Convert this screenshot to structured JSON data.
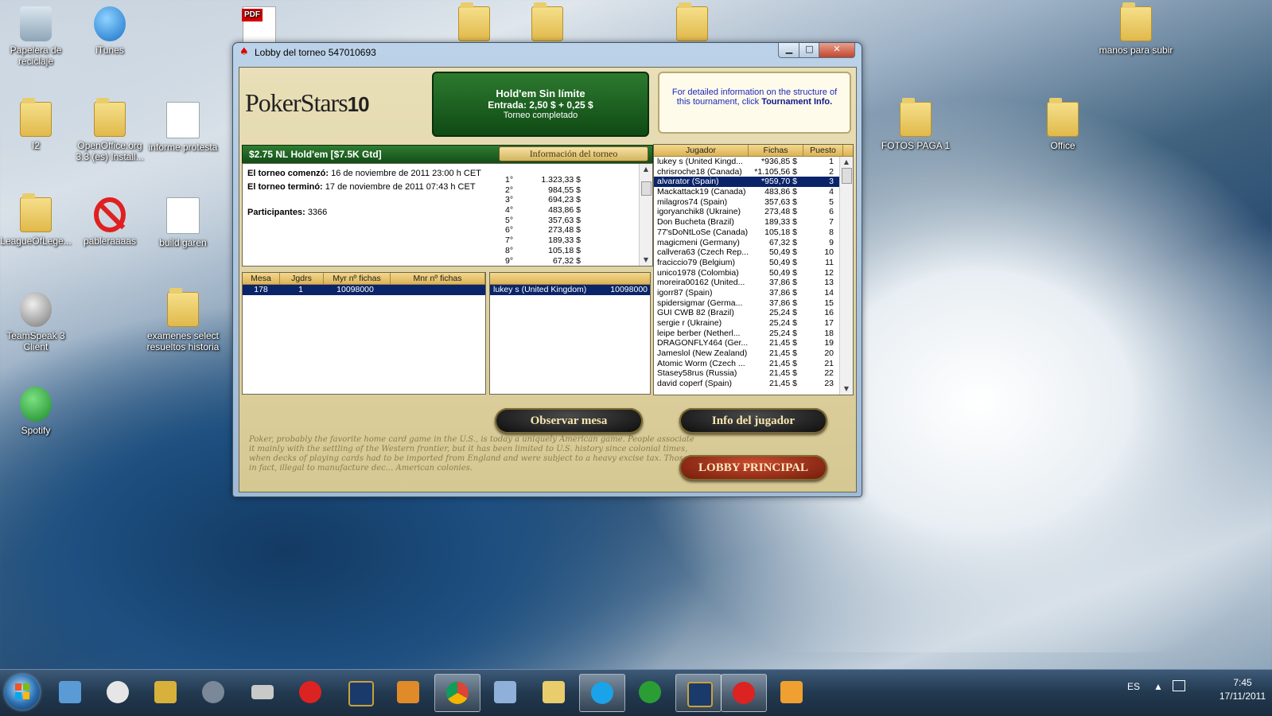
{
  "desktop": {
    "icons": [
      {
        "label": "Papelera de reciclaje",
        "icon": "recycle-bin-icon"
      },
      {
        "label": "iTunes",
        "icon": "itunes-icon"
      },
      {
        "label": "I2",
        "icon": "folder-icon"
      },
      {
        "label": "OpenOffice.org 3.3 (es) Install...",
        "icon": "folder-icon"
      },
      {
        "label": "informe protesta",
        "icon": "document-icon"
      },
      {
        "label": "LeagueOfLege...",
        "icon": "folder-icon"
      },
      {
        "label": "pableraaaas",
        "icon": "no-entry-icon"
      },
      {
        "label": "build garen",
        "icon": "document-icon"
      },
      {
        "label": "TeamSpeak 3 Client",
        "icon": "teamspeak-icon"
      },
      {
        "label": "examenes select resueltos historia",
        "icon": "folder-icon"
      },
      {
        "label": "Spotify",
        "icon": "spotify-icon"
      },
      {
        "label": "manos para subir",
        "icon": "folder-icon"
      },
      {
        "label": "FOTOS PAGA 1",
        "icon": "folder-icon"
      },
      {
        "label": "Office",
        "icon": "folder-icon"
      }
    ]
  },
  "window": {
    "title": "Lobby del torneo 547010693",
    "logo_text": "PokerStars",
    "logo_badge": "10",
    "game": {
      "name": "Hold'em Sin límite",
      "entry": "Entrada: 2,50 $ + 0,25 $",
      "status": "Torneo completado"
    },
    "info_text": "For detailed information on the structure of this tournament, click",
    "info_link": "Tournament Info.",
    "tournament_name": "$2.75 NL Hold'em [$7.5K Gtd]",
    "tournament_info_button": "Información del torneo",
    "started_label": "El torneo comenzó:",
    "started_value": "16 de noviembre de 2011 23:00 h CET",
    "ended_label": "El torneo terminó:",
    "ended_value": "17 de noviembre de 2011 07:43 h CET",
    "participants_label": "Participantes:",
    "participants_value": "3366",
    "prizes": [
      {
        "place": "1°",
        "amount": "1.323,33 $"
      },
      {
        "place": "2°",
        "amount": "984,55 $"
      },
      {
        "place": "3°",
        "amount": "694,23 $"
      },
      {
        "place": "4°",
        "amount": "483,86 $"
      },
      {
        "place": "5°",
        "amount": "357,63 $"
      },
      {
        "place": "6°",
        "amount": "273,48 $"
      },
      {
        "place": "7°",
        "amount": "189,33 $"
      },
      {
        "place": "8°",
        "amount": "105,18 $"
      },
      {
        "place": "9°",
        "amount": "67,32 $"
      }
    ],
    "tables": {
      "headers": [
        "Mesa",
        "Jgdrs",
        "Myr nº fichas",
        "Mnr nº fichas"
      ],
      "rows": [
        [
          "178",
          "1",
          "10098000",
          ""
        ]
      ]
    },
    "table_players": [
      {
        "name": "lukey s (United Kingdom)",
        "chips": "10098000"
      }
    ],
    "players": {
      "headers": [
        "Jugador",
        "Fichas",
        "Puesto"
      ],
      "rows": [
        [
          "lukey s (United Kingd...",
          "*936,85 $",
          "1"
        ],
        [
          "chrisroche18 (Canada)",
          "*1.105,56 $",
          "2"
        ],
        [
          "alvarator (Spain)",
          "*959,70 $",
          "3"
        ],
        [
          "Mackattack19 (Canada)",
          "483,86 $",
          "4"
        ],
        [
          "milagros74 (Spain)",
          "357,63 $",
          "5"
        ],
        [
          "igoryanchik8 (Ukraine)",
          "273,48 $",
          "6"
        ],
        [
          "Don Bucheta (Brazil)",
          "189,33 $",
          "7"
        ],
        [
          "77'sDoNtLoSe (Canada)",
          "105,18 $",
          "8"
        ],
        [
          "magicmeni (Germany)",
          "67,32 $",
          "9"
        ],
        [
          "callvera63 (Czech Rep...",
          "50,49 $",
          "10"
        ],
        [
          "fraciccio79 (Belgium)",
          "50,49 $",
          "11"
        ],
        [
          "unico1978 (Colombia)",
          "50,49 $",
          "12"
        ],
        [
          "moreira00162 (United...",
          "37,86 $",
          "13"
        ],
        [
          "igorr87 (Spain)",
          "37,86 $",
          "14"
        ],
        [
          "spidersigmar (Germa...",
          "37,86 $",
          "15"
        ],
        [
          "GUI CWB 82 (Brazil)",
          "25,24 $",
          "16"
        ],
        [
          "sergie r (Ukraine)",
          "25,24 $",
          "17"
        ],
        [
          "leipe berber (Netherl...",
          "25,24 $",
          "18"
        ],
        [
          "DRAGONFLY464 (Ger...",
          "21,45 $",
          "19"
        ],
        [
          "Jameslol (New Zealand)",
          "21,45 $",
          "20"
        ],
        [
          "Atomic Worm (Czech ...",
          "21,45 $",
          "21"
        ],
        [
          "Stasey58rus (Russia)",
          "21,45 $",
          "22"
        ],
        [
          "david coperf (Spain)",
          "21,45 $",
          "23"
        ]
      ],
      "selected_index": 2
    },
    "buttons": {
      "observe": "Observar mesa",
      "player_info": "Info del jugador",
      "main_lobby": "LOBBY PRINCIPAL"
    },
    "background_script": "Poker, probably the favorite home card game in the U.S., is today a uniquely American game. People associate it mainly with the settling of the Western frontier, but it has been limited to U.S. history since colonial times, when decks of playing cards had to be imported from England and were subject to a heavy excise tax. Those, in fact, illegal to manufacture dec... American colonies."
  },
  "taskbar": {
    "language": "ES",
    "time": "7:45",
    "date": "17/11/2011"
  },
  "colors": {
    "poker_green": "#1e6a22",
    "selection_blue": "#0a246a",
    "header_gold": "#dcb258"
  }
}
